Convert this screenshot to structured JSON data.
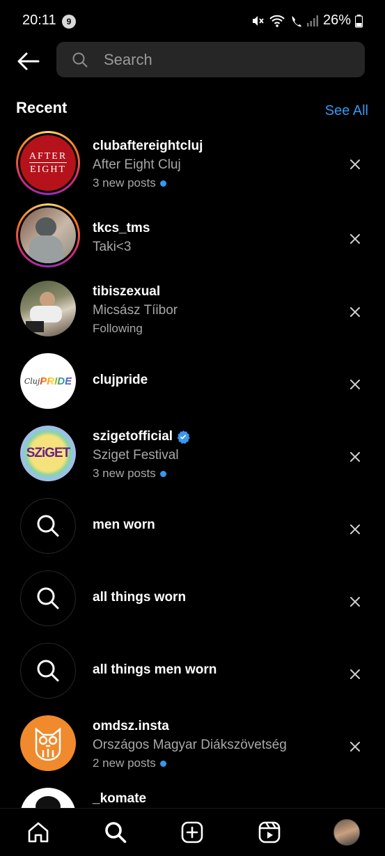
{
  "status_bar": {
    "time": "20:11",
    "notification_count": "9",
    "battery": "26%"
  },
  "search": {
    "placeholder": "Search"
  },
  "recent": {
    "title": "Recent",
    "see_all": "See All"
  },
  "items": [
    {
      "type": "account",
      "username": "clubaftereightcluj",
      "name": "After Eight Cluj",
      "meta": "3 new posts",
      "meta_dot": true,
      "story_ring": true,
      "avatar_text": [
        "AFTER",
        "EIGHT"
      ]
    },
    {
      "type": "account",
      "username": "tkcs_tms",
      "name": "Taki<3",
      "meta": "",
      "story_ring": true
    },
    {
      "type": "account",
      "username": "tibiszexual",
      "name": "Micsász Tíibor",
      "meta": "Following",
      "meta_dot": false,
      "story_ring": false
    },
    {
      "type": "account",
      "username": "clujpride",
      "name": "",
      "meta": "",
      "story_ring": false,
      "avatar_text": [
        "Cluj",
        "PRIDE"
      ]
    },
    {
      "type": "account",
      "username": "szigetofficial",
      "name": "Sziget Festival",
      "meta": "3 new posts",
      "meta_dot": true,
      "verified": true,
      "story_ring": false,
      "avatar_text": [
        "SZiGET"
      ]
    },
    {
      "type": "search",
      "query": "men worn"
    },
    {
      "type": "search",
      "query": "all things worn"
    },
    {
      "type": "search",
      "query": "all things men worn"
    },
    {
      "type": "account",
      "username": "omdsz.insta",
      "name": "Országos Magyar Diákszövetség",
      "meta": "2 new posts",
      "meta_dot": true,
      "story_ring": false
    },
    {
      "type": "account",
      "username": "_komate",
      "name": "",
      "meta": "",
      "story_ring": false
    }
  ],
  "colors": {
    "accent": "#3897f0",
    "background": "#000000",
    "muted_text": "#a8a8a8",
    "search_bg": "#262626"
  },
  "nav": {
    "icons": [
      "home-icon",
      "search-icon",
      "create-icon",
      "reels-icon",
      "profile-avatar"
    ]
  }
}
